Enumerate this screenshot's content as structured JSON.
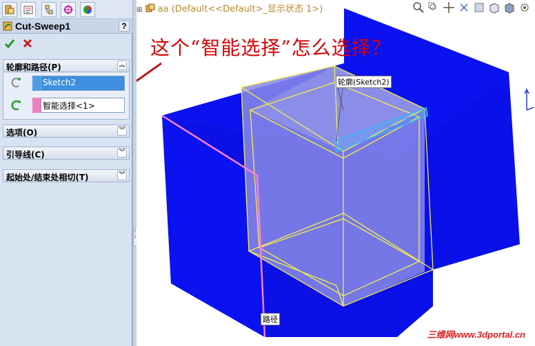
{
  "tabs": [
    {
      "icon": "feature-manager-icon"
    },
    {
      "icon": "property-manager-icon"
    },
    {
      "icon": "configuration-manager-icon"
    },
    {
      "icon": "dim-xpert-icon"
    },
    {
      "icon": "display-manager-icon"
    }
  ],
  "feature": {
    "title": "Cut-Sweep1",
    "help": "?"
  },
  "groups": {
    "profile_path": "轮廓和路径(P)",
    "options": "选项(O)",
    "guide_curves": "引导线(C)",
    "tangency": "起始处/结束处相切(T)"
  },
  "profile_selection": "Sketch2",
  "path_selection": "智能选择<1>",
  "breadcrumb": "aa  (Default<<Default>_显示状态 1>)",
  "annotation": "这个“智能选择”怎么选择？",
  "callouts": {
    "profile": "轮廓(Sketch2)",
    "path": "路径"
  },
  "watermark": "三维网www.3dportal.cn",
  "colors": {
    "panel_bg": "#d8e3f1",
    "profile_swatch": "#4a9ee6",
    "path_swatch": "#ee7fc0",
    "model_blue": "#0b12f0",
    "highlight_yellow": "#f5ef4a",
    "annotation_red": "#d80000"
  }
}
